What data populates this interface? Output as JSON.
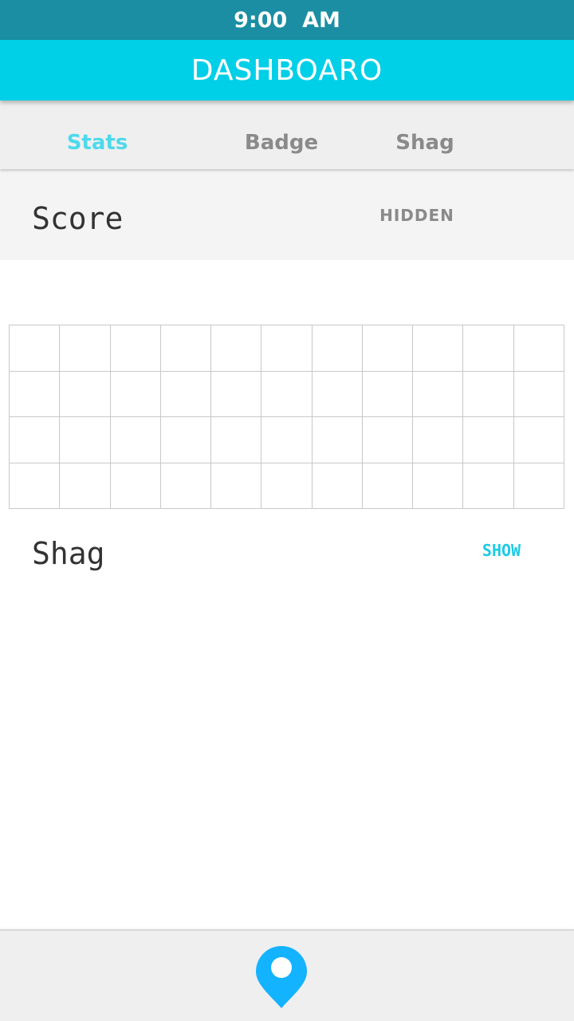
{
  "status_bar": {
    "time": "9:00  AM"
  },
  "app_bar": {
    "title": "DASHBOARO"
  },
  "tabs": [
    {
      "label": "Stats",
      "active": true
    },
    {
      "label": "Badge",
      "active": false
    },
    {
      "label": "Shag",
      "active": false
    }
  ],
  "score_section": {
    "title": "Score",
    "toggle_label": "HIDDEN"
  },
  "grid": {
    "rows": 4,
    "columns": 11
  },
  "shag_section": {
    "title": "Shag",
    "toggle_label": "SHOW"
  },
  "bottom_bar": {
    "icon": "location-pin-icon"
  },
  "colors": {
    "status_bar": "#1b8ea3",
    "app_bar": "#00cfe8",
    "active_tab": "#4dd9ec",
    "show_link": "#1ccbe6",
    "location_pin": "#14b3ff"
  }
}
